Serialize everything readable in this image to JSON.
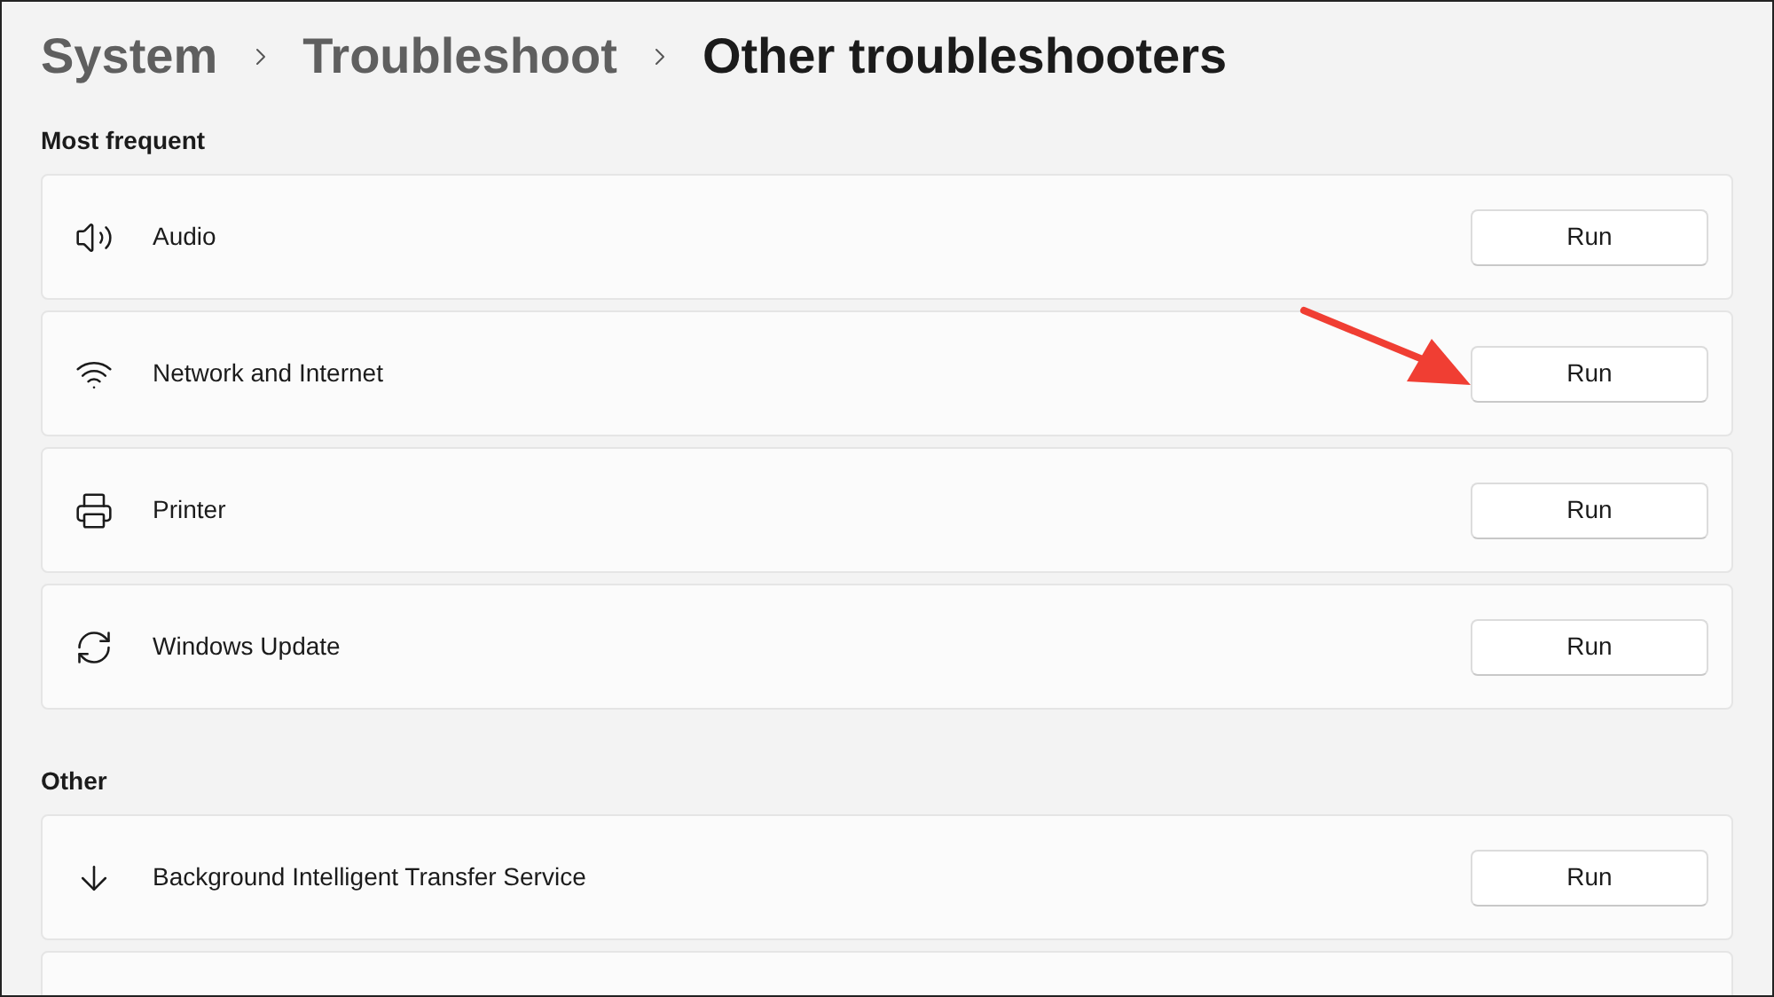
{
  "breadcrumb": [
    {
      "label": "System",
      "current": false
    },
    {
      "label": "Troubleshoot",
      "current": false
    },
    {
      "label": "Other troubleshooters",
      "current": true
    }
  ],
  "sections": [
    {
      "title": "Most frequent",
      "items": [
        {
          "kind": "audio",
          "label": "Audio",
          "button": "Run",
          "annotated": false
        },
        {
          "kind": "network",
          "label": "Network and Internet",
          "button": "Run",
          "annotated": true
        },
        {
          "kind": "printer",
          "label": "Printer",
          "button": "Run",
          "annotated": false
        },
        {
          "kind": "update",
          "label": "Windows Update",
          "button": "Run",
          "annotated": false
        }
      ]
    },
    {
      "title": "Other",
      "items": [
        {
          "kind": "download",
          "label": "Background Intelligent Transfer Service",
          "button": "Run",
          "annotated": false
        }
      ]
    }
  ]
}
